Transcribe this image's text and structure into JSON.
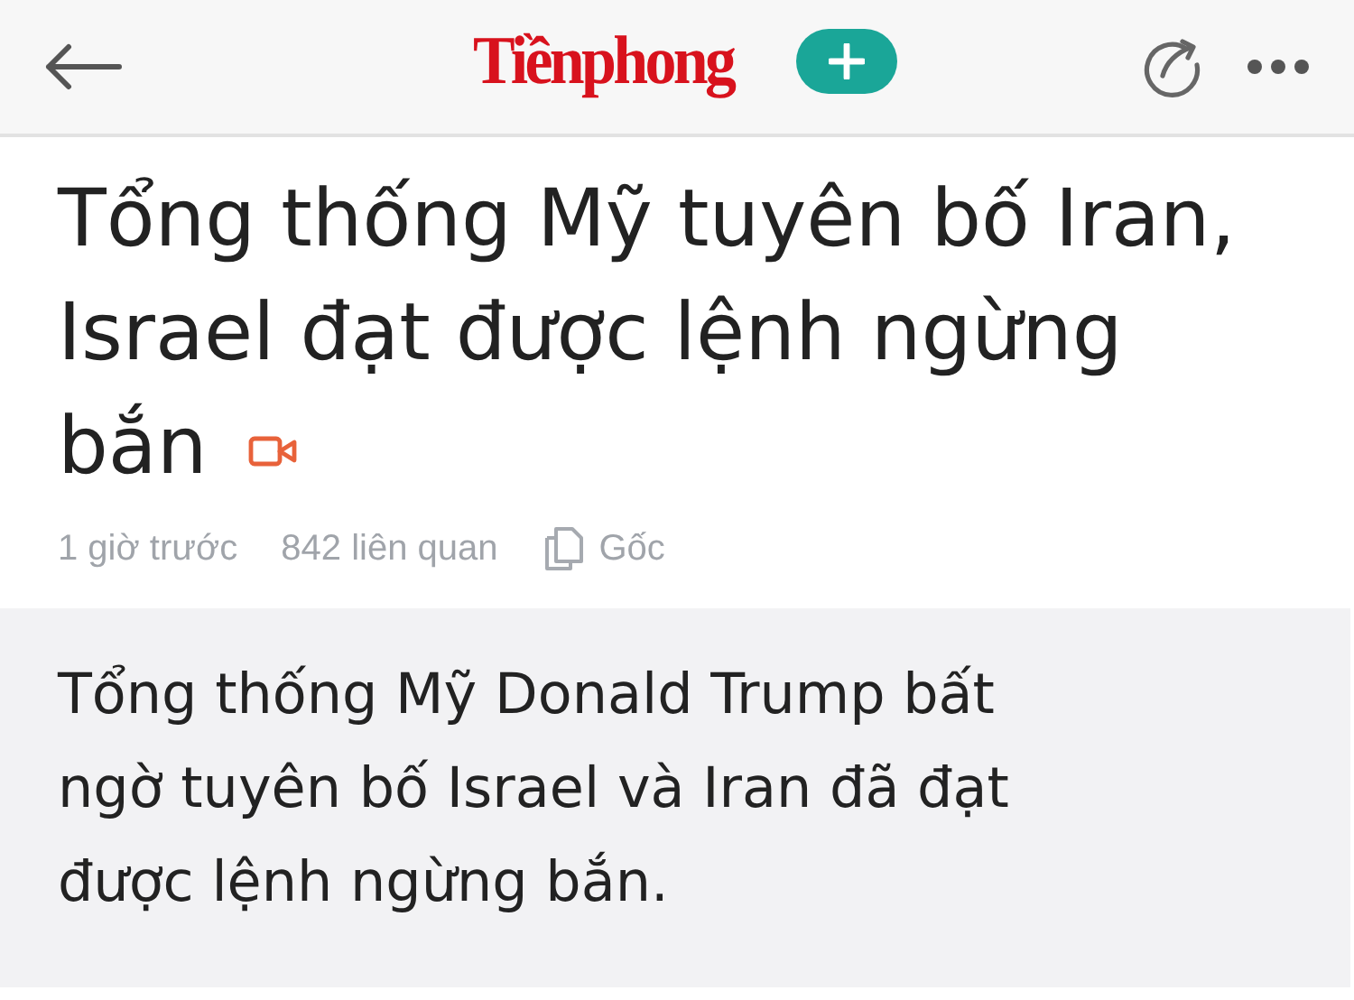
{
  "header": {
    "logo": "Tiềnphong"
  },
  "article": {
    "title": "Tổng thống Mỹ tuyên bố Iran, Israel đạt được lệnh ngừng bắn",
    "has_video": true,
    "meta": {
      "time": "1 giờ trước",
      "related": "842 liên quan",
      "source": "Gốc"
    },
    "summary": "Tổng thống Mỹ Donald Trump bất ngờ tuyên bố Israel và Iran đã đạt được lệnh ngừng bắn."
  }
}
